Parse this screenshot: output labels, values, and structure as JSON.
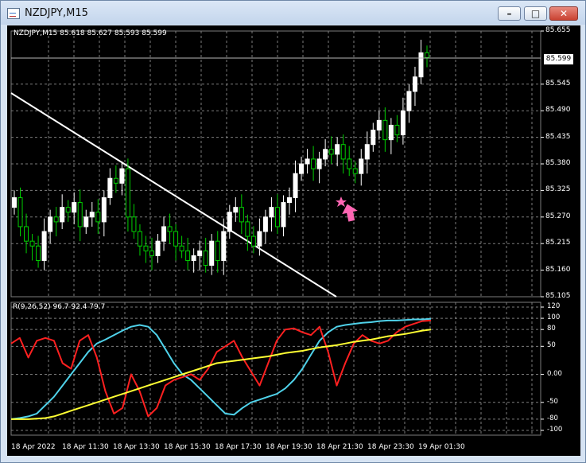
{
  "window": {
    "title": "NZDJPY,M15",
    "minimize_glyph": "–",
    "maximize_glyph": "□",
    "close_glyph": "✕"
  },
  "chart": {
    "info_line": "NZDJPY,M15  85.618 85.627 85.593 85.599",
    "current_price": "85.599",
    "price_labels": [
      "85.655",
      "85.545",
      "85.490",
      "85.435",
      "85.380",
      "85.325",
      "85.270",
      "85.215",
      "85.160",
      "85.105"
    ],
    "indicator_label": "R(9,26,52) 96.7 92.4 79.7",
    "oscillator_labels": [
      "120",
      "100",
      "80",
      "50",
      "0.00",
      "-50",
      "-80",
      "-100"
    ],
    "time_labels": [
      "18 Apr 2022",
      "18 Apr 11:30",
      "18 Apr 13:30",
      "18 Apr 15:30",
      "18 Apr 17:30",
      "18 Apr 19:30",
      "18 Apr 21:30",
      "18 Apr 23:30",
      "19 Apr 01:30"
    ],
    "colors": {
      "bg": "#000000",
      "grid": "#7d7d7d",
      "bull": "#ffffff",
      "bear": "#00d000",
      "trendline": "#ffffff",
      "arrow": "#ff66b3",
      "cyan": "#4fd2ea",
      "red": "#ff2020",
      "yellow": "#ffff33"
    },
    "signal_icons": [
      "star-icon",
      "up-arrow-icon"
    ]
  },
  "chart_data": [
    {
      "type": "candlestick",
      "title": "NZDJPY,M15",
      "xlabel": "",
      "ylabel": "",
      "ylim": [
        85.105,
        85.655
      ],
      "time_range": [
        "18 Apr 2022",
        "19 Apr 01:30"
      ],
      "series": [
        {
          "name": "NZDJPY,M15",
          "close": [
            85.31,
            85.25,
            85.22,
            85.21,
            85.18,
            85.24,
            85.27,
            85.26,
            85.29,
            85.28,
            85.3,
            85.25,
            85.27,
            85.28,
            85.26,
            85.31,
            85.35,
            85.34,
            85.37,
            85.27,
            85.24,
            85.21,
            85.2,
            85.19,
            85.22,
            85.25,
            85.24,
            85.21,
            85.2,
            85.18,
            85.19,
            85.2,
            85.17,
            85.22,
            85.18,
            85.24,
            85.28,
            85.29,
            85.26,
            85.23,
            85.21,
            85.24,
            85.27,
            85.29,
            85.25,
            85.3,
            85.31,
            85.36,
            85.38,
            85.39,
            85.37,
            85.39,
            85.41,
            85.4,
            85.42,
            85.39,
            85.37,
            85.36,
            85.39,
            85.42,
            85.45,
            85.47,
            85.43,
            85.46,
            85.44,
            85.49,
            85.53,
            85.56,
            85.61,
            85.6
          ]
        }
      ]
    },
    {
      "type": "line",
      "title": "R(9,26,52)",
      "ylim": [
        -100,
        120
      ],
      "series": [
        {
          "name": "",
          "values": [
            -80,
            -78,
            -75,
            -70,
            -55,
            -40,
            -20,
            0,
            20,
            40,
            55,
            62,
            70,
            78,
            85,
            88,
            85,
            70,
            45,
            20,
            0,
            -10,
            -25,
            -40,
            -55,
            -70,
            -72,
            -60,
            -50,
            -45,
            -40,
            -35,
            -25,
            -10,
            10,
            35,
            60,
            75,
            85,
            88,
            90,
            92,
            93,
            95,
            96,
            96,
            97,
            98,
            98,
            99
          ]
        },
        {
          "name": "",
          "values": [
            55,
            65,
            30,
            60,
            65,
            60,
            20,
            10,
            60,
            70,
            30,
            -30,
            -70,
            -60,
            0,
            -30,
            -75,
            -60,
            -20,
            -10,
            -5,
            0,
            -10,
            10,
            40,
            50,
            60,
            30,
            5,
            -20,
            20,
            60,
            80,
            82,
            75,
            70,
            85,
            40,
            -20,
            20,
            55,
            70,
            60,
            55,
            60,
            75,
            85,
            90,
            95,
            96
          ]
        },
        {
          "name": "",
          "values": [
            -80,
            -80,
            -80,
            -79,
            -78,
            -75,
            -70,
            -65,
            -60,
            -55,
            -50,
            -45,
            -40,
            -35,
            -30,
            -25,
            -20,
            -15,
            -10,
            -5,
            0,
            5,
            10,
            15,
            20,
            22,
            24,
            26,
            28,
            30,
            32,
            35,
            38,
            40,
            42,
            45,
            48,
            50,
            52,
            55,
            58,
            60,
            62,
            65,
            68,
            70,
            72,
            75,
            78,
            80
          ]
        }
      ]
    }
  ]
}
